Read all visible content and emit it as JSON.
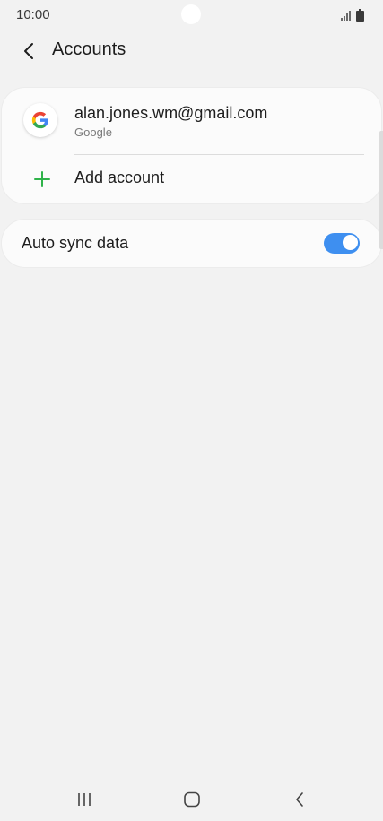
{
  "status_bar": {
    "time": "10:00",
    "signal_icon": "signal-icon",
    "battery_icon": "battery-icon"
  },
  "header": {
    "back_icon": "chevron-left-icon",
    "title": "Accounts"
  },
  "accounts": [
    {
      "email": "alan.jones.wm@gmail.com",
      "provider": "Google",
      "icon": "google-icon"
    }
  ],
  "add_account": {
    "icon": "plus-icon",
    "label": "Add account",
    "icon_color": "#2fb34a"
  },
  "auto_sync": {
    "label": "Auto sync data",
    "enabled": true,
    "toggle_color": "#3e8ff0"
  },
  "nav_bar": {
    "recents_icon": "recent-apps-icon",
    "home_icon": "home-icon",
    "back_icon": "back-icon"
  },
  "colors": {
    "background": "#f2f2f2",
    "card": "#fbfbfb",
    "text_primary": "#1d1d1d",
    "text_secondary": "#7a7a7a"
  }
}
